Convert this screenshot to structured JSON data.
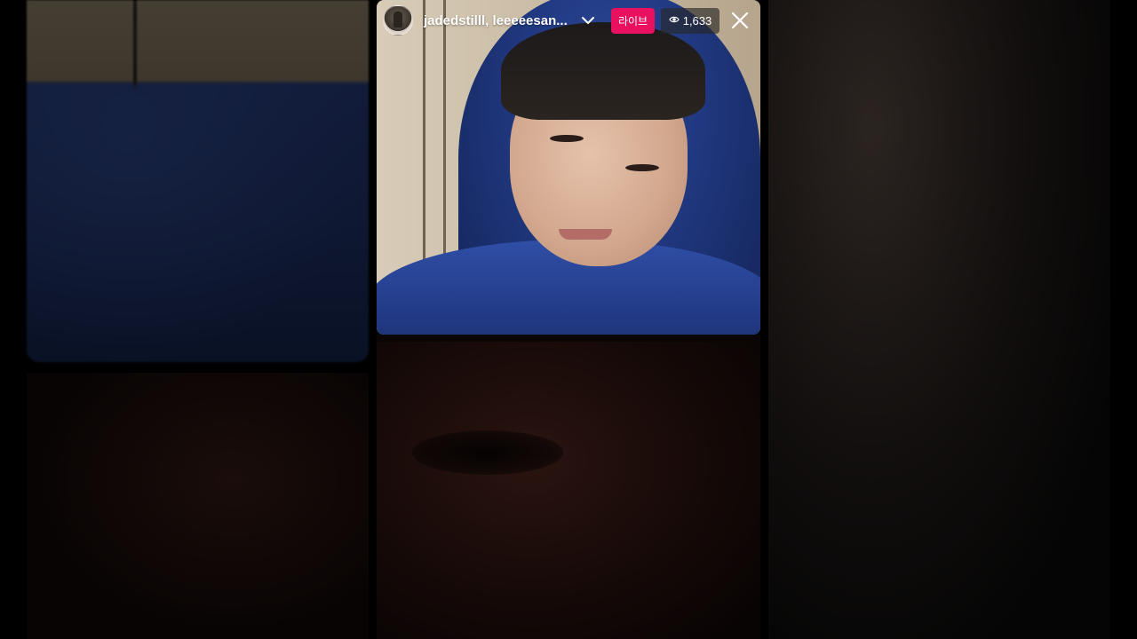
{
  "live": {
    "username": "jadedstilll, leeeeesan...",
    "live_label": "라이브",
    "viewer_count": "1,633",
    "icons": {
      "expand": "chevron-down-icon",
      "viewers": "eye-icon",
      "close": "close-icon"
    },
    "colors": {
      "live_badge": "#e8105f",
      "viewer_badge_bg": "#282828"
    }
  }
}
